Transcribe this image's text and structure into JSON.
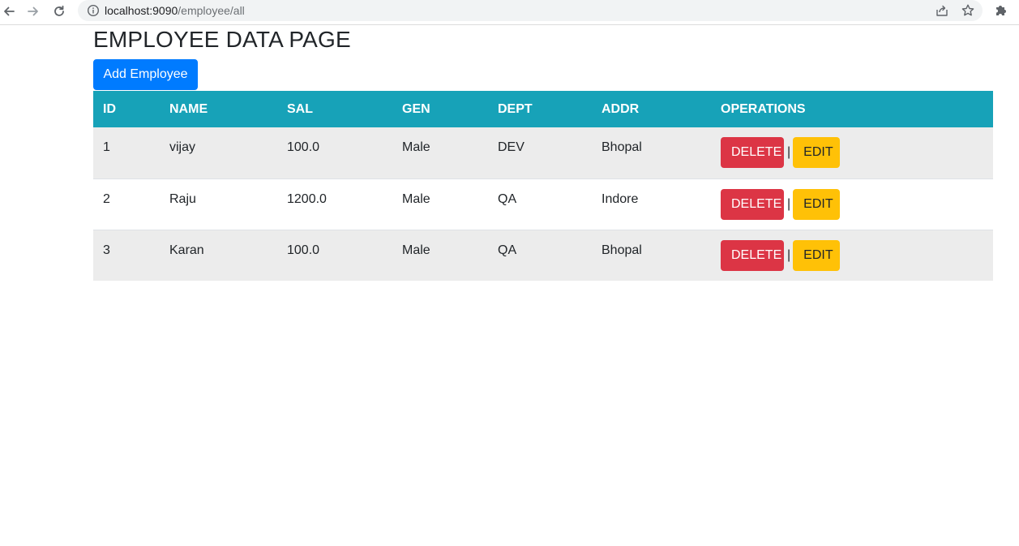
{
  "browser": {
    "url_host": "localhost:9090",
    "url_path": "/employee/all",
    "icons": [
      "back-arrow-icon",
      "forward-arrow-icon",
      "reload-icon",
      "site-info-icon",
      "share-icon",
      "bookmark-star-icon",
      "extensions-puzzle-icon"
    ]
  },
  "page": {
    "title": "EMPLOYEE DATA PAGE",
    "add_button_label": "Add Employee"
  },
  "table": {
    "headers": [
      "ID",
      "NAME",
      "SAL",
      "GEN",
      "DEPT",
      "ADDR",
      "OPERATIONS"
    ],
    "rows": [
      {
        "id": "1",
        "name": "vijay",
        "sal": "100.0",
        "gen": "Male",
        "dept": "DEV",
        "addr": "Bhopal"
      },
      {
        "id": "2",
        "name": "Raju",
        "sal": "1200.0",
        "gen": "Male",
        "dept": "QA",
        "addr": "Indore"
      },
      {
        "id": "3",
        "name": "Karan",
        "sal": "100.0",
        "gen": "Male",
        "dept": "QA",
        "addr": "Bhopal"
      }
    ],
    "delete_label": "DELETE",
    "edit_label": "EDIT",
    "separator": "|"
  },
  "colors": {
    "header_bg": "#17a2b8",
    "primary_button": "#007bff",
    "delete_button": "#dc3545",
    "edit_button": "#ffc107",
    "striped_row": "#ececec"
  }
}
